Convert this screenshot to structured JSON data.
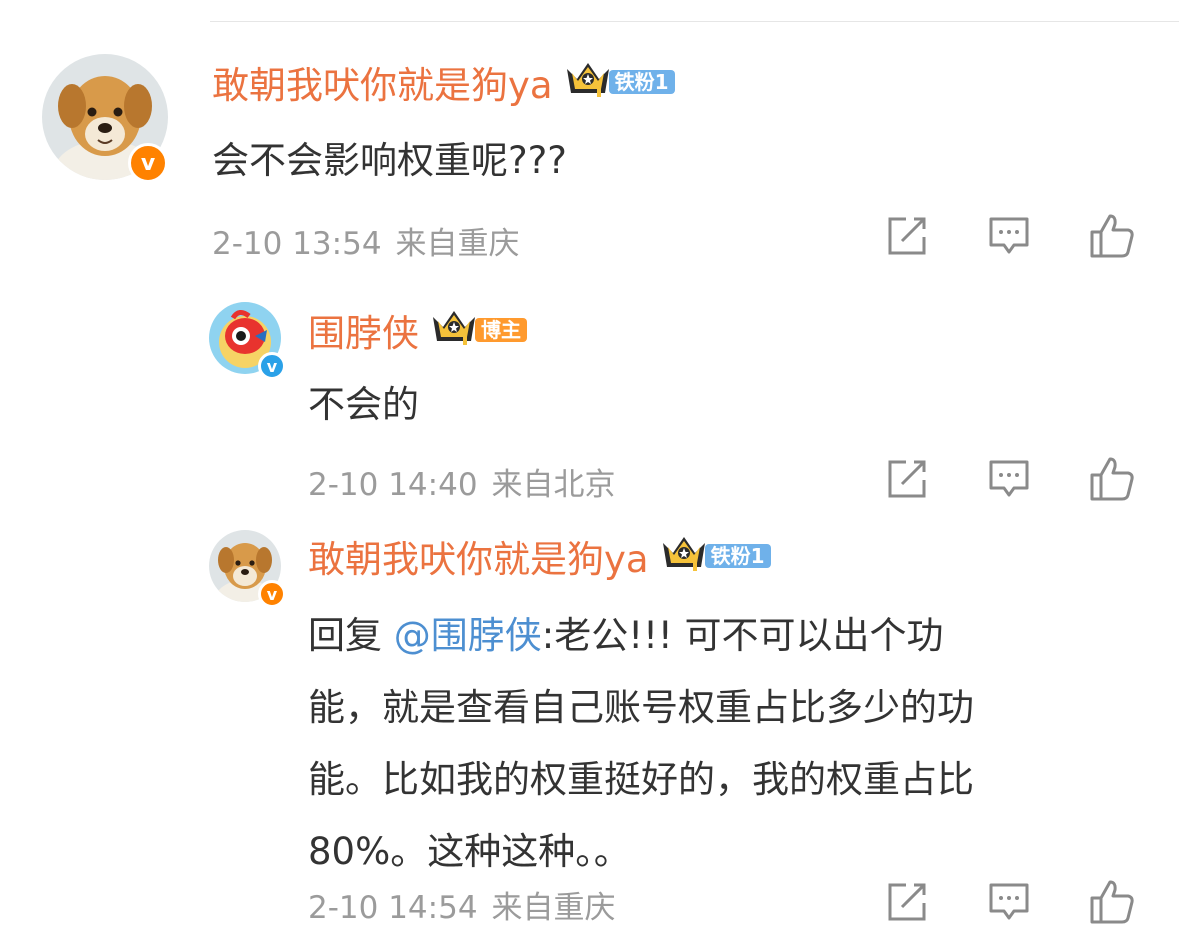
{
  "comments": [
    {
      "username": "敢朝我吠你就是狗ya",
      "tag": "铁粉1",
      "text": "会不会影响权重呢???",
      "time": "2-10 13:54",
      "location": "来自重庆"
    },
    {
      "username": "围脖侠",
      "tag": "博主",
      "text": "不会的",
      "time": "2-10 14:40",
      "location": "来自北京"
    },
    {
      "username": "敢朝我吠你就是狗ya",
      "tag": "铁粉1",
      "reply_prefix": "回复 ",
      "mention": "@围脖侠",
      "text_line1": ":老公!!! 可不可以出个功",
      "text_line2": "能，就是查看自己账号权重占比多少的功",
      "text_line3": "能。比如我的权重挺好的，我的权重占比",
      "text_line4": "80%。这种这种。。",
      "time": "2-10 14:54",
      "location": "来自重庆"
    }
  ],
  "colors": {
    "username": "#eb7340",
    "text": "#333333",
    "meta": "#9b9b9b",
    "mention": "#4d8fd1",
    "verified_orange": "#ff8200",
    "verified_blue": "#2aa1e8",
    "fan_tag": "#6fb1ea",
    "host_tag": "#ff9a2e"
  },
  "icons": [
    "share-icon",
    "comment-icon",
    "like-icon",
    "crown-icon",
    "verified-badge-icon"
  ]
}
